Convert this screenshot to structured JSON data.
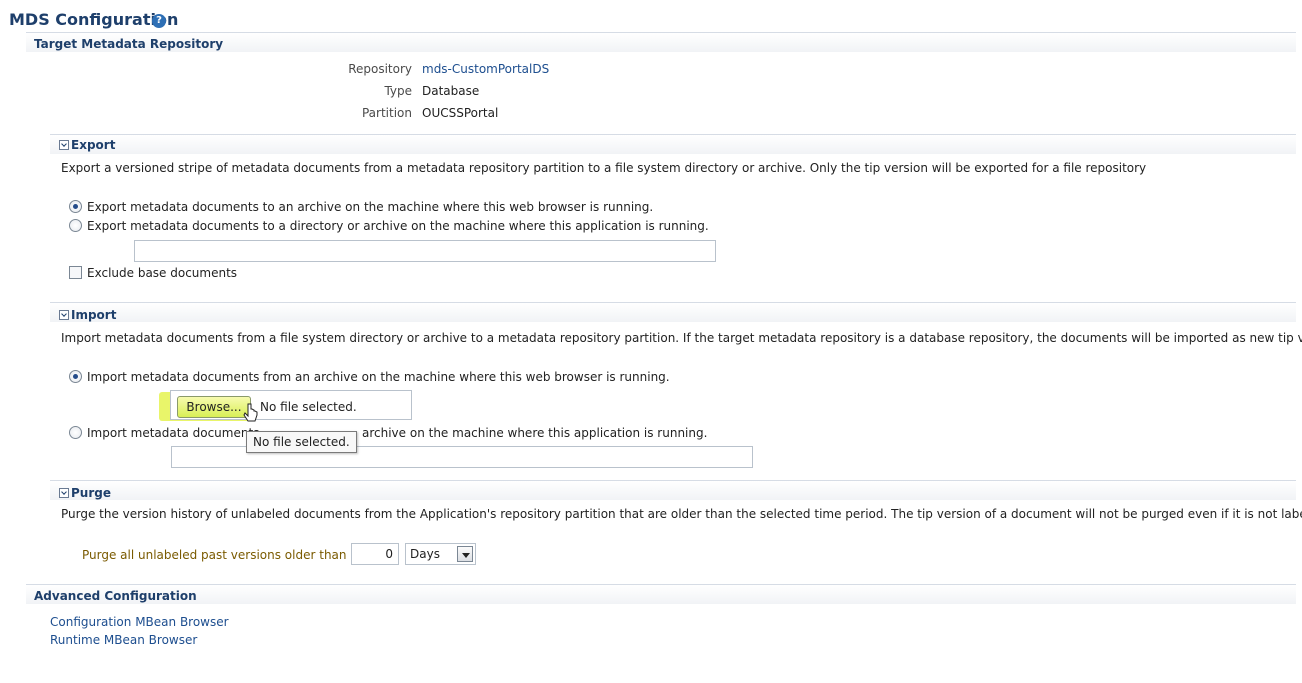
{
  "page": {
    "title": "MDS Configuration",
    "help_icon": "help-icon"
  },
  "target": {
    "heading": "Target Metadata Repository",
    "fields": [
      {
        "label": "Repository",
        "value": "mds-CustomPortalDS"
      },
      {
        "label": "Type",
        "value": "Database"
      },
      {
        "label": "Partition",
        "value": "OUCSSPortal"
      }
    ]
  },
  "export": {
    "heading": "Export",
    "description": "Export a versioned stripe of metadata documents from a metadata repository partition to a file system directory or archive. Only the tip version will be exported for a file repository",
    "options": [
      {
        "label": "Export metadata documents to an archive on the machine where this web browser is running.",
        "selected": true
      },
      {
        "label": "Export metadata documents to a directory or archive on the machine where this application is running.",
        "selected": false
      }
    ],
    "path_value": "",
    "exclude_label": "Exclude base documents",
    "exclude_checked": false
  },
  "import": {
    "heading": "Import",
    "description": "Import metadata documents from a file system directory or archive to a metadata repository partition. If the target metadata repository is a database repository, the documents will be imported as new tip versions.",
    "option1": {
      "label": "Import metadata documents from an archive on the machine where this web browser is running.",
      "selected": true
    },
    "browse_label": "Browse...",
    "file_status": "No file selected.",
    "option2_left": "Import metadata documents",
    "option2_right": "archive on the machine where this application is running.",
    "option2_selected": false,
    "tooltip": "No file selected.",
    "path_value": ""
  },
  "purge": {
    "heading": "Purge",
    "description": "Purge the version history of unlabeled documents from the Application's repository partition that are older than the selected time period. The tip version of a document will not be purged even if it is not labeled.",
    "label": "Purge all unlabeled past versions older than :",
    "value": "0",
    "unit": "Days"
  },
  "advanced": {
    "heading": "Advanced Configuration",
    "links": [
      "Configuration MBean Browser",
      "Runtime MBean Browser"
    ]
  }
}
